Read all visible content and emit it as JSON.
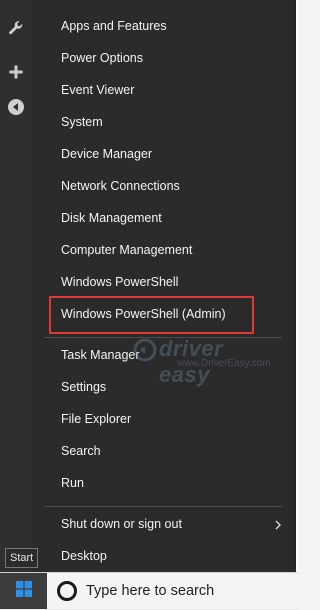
{
  "sidebar_icons": [
    "wrench-icon",
    "plus-icon",
    "back-arrow-icon"
  ],
  "menu": {
    "group1": [
      "Apps and Features",
      "Power Options",
      "Event Viewer",
      "System",
      "Device Manager",
      "Network Connections",
      "Disk Management",
      "Computer Management",
      "Windows PowerShell",
      "Windows PowerShell (Admin)"
    ],
    "group2": [
      "Task Manager",
      "Settings",
      "File Explorer",
      "Search",
      "Run"
    ],
    "group3": [
      "Shut down or sign out",
      "Desktop"
    ]
  },
  "watermark": {
    "brand": "driver easy",
    "url": "www.DriverEasy.com"
  },
  "highlight_color": "#e0383b",
  "start_tooltip": "Start",
  "search": {
    "placeholder": "Type here to search"
  }
}
